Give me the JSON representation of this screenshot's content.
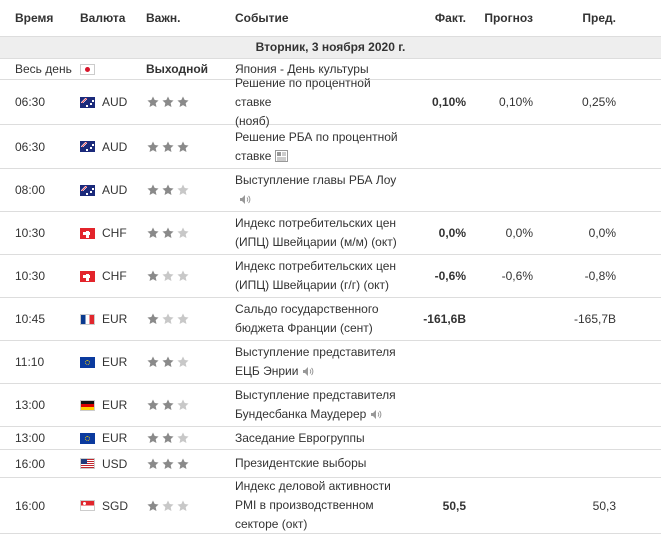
{
  "header": {
    "time": "Время",
    "currency": "Валюта",
    "importance": "Важн.",
    "event": "Событие",
    "actual": "Факт.",
    "forecast": "Прогноз",
    "previous": "Пред."
  },
  "day": "Вторник, 3 ноября 2020 г.",
  "colors": {
    "star_filled": "#8a8a8a",
    "star_empty": "#c8c8c8",
    "border": "#dddddd",
    "daybar_bg": "#eeeeee"
  },
  "rows": [
    {
      "time": "Весь день",
      "flag": "jp",
      "currency": "",
      "importance": "Выходной",
      "stars": 0,
      "event_lines": [
        "Япония - День культуры"
      ],
      "icon": "",
      "actual": "",
      "forecast": "",
      "previous": ""
    },
    {
      "time": "06:30",
      "flag": "au",
      "currency": "AUD",
      "importance": "",
      "stars": 3,
      "event_lines": [
        "Решение по процентной ставке",
        "(нояб)"
      ],
      "icon": "",
      "actual": "0,10%",
      "forecast": "0,10%",
      "previous": "0,25%"
    },
    {
      "time": "06:30",
      "flag": "au",
      "currency": "AUD",
      "importance": "",
      "stars": 3,
      "event_lines": [
        "Решение РБА по процентной",
        "ставке"
      ],
      "icon": "document-icon",
      "actual": "",
      "forecast": "",
      "previous": ""
    },
    {
      "time": "08:00",
      "flag": "au",
      "currency": "AUD",
      "importance": "",
      "stars": 2,
      "event_lines": [
        "Выступление главы РБА Лоу",
        ""
      ],
      "icon": "speaker-icon",
      "actual": "",
      "forecast": "",
      "previous": ""
    },
    {
      "time": "10:30",
      "flag": "ch",
      "currency": "CHF",
      "importance": "",
      "stars": 2,
      "event_lines": [
        "Индекс потребительских цен",
        "(ИПЦ) Швейцарии (м/м) (окт)"
      ],
      "icon": "",
      "actual": "0,0%",
      "forecast": "0,0%",
      "previous": "0,0%"
    },
    {
      "time": "10:30",
      "flag": "ch",
      "currency": "CHF",
      "importance": "",
      "stars": 1,
      "event_lines": [
        "Индекс потребительских цен",
        "(ИПЦ) Швейцарии (г/г) (окт)"
      ],
      "icon": "",
      "actual": "-0,6%",
      "forecast": "-0,6%",
      "previous": "-0,8%"
    },
    {
      "time": "10:45",
      "flag": "fr",
      "currency": "EUR",
      "importance": "",
      "stars": 1,
      "event_lines": [
        "Сальдо государственного",
        "бюджета Франции (сент)"
      ],
      "icon": "",
      "actual": "-161,6B",
      "forecast": "",
      "previous": "-165,7B"
    },
    {
      "time": "11:10",
      "flag": "eu",
      "currency": "EUR",
      "importance": "",
      "stars": 2,
      "event_lines": [
        "Выступление представителя",
        "ЕЦБ Энрии"
      ],
      "icon": "speaker-icon",
      "actual": "",
      "forecast": "",
      "previous": ""
    },
    {
      "time": "13:00",
      "flag": "de",
      "currency": "EUR",
      "importance": "",
      "stars": 2,
      "event_lines": [
        "Выступление представителя",
        "Бундесбанка Маудерер"
      ],
      "icon": "speaker-icon",
      "actual": "",
      "forecast": "",
      "previous": ""
    },
    {
      "time": "13:00",
      "flag": "eu",
      "currency": "EUR",
      "importance": "",
      "stars": 2,
      "event_lines": [
        "Заседание Еврогруппы"
      ],
      "icon": "",
      "actual": "",
      "forecast": "",
      "previous": ""
    },
    {
      "time": "16:00",
      "flag": "us",
      "currency": "USD",
      "importance": "",
      "stars": 3,
      "event_lines": [
        "Президентские выборы"
      ],
      "icon": "",
      "actual": "",
      "forecast": "",
      "previous": ""
    },
    {
      "time": "16:00",
      "flag": "sg",
      "currency": "SGD",
      "importance": "",
      "stars": 1,
      "event_lines": [
        "Индекс деловой активности",
        "PMI в производственном",
        "секторе (окт)"
      ],
      "icon": "",
      "actual": "50,5",
      "forecast": "",
      "previous": "50,3"
    }
  ]
}
